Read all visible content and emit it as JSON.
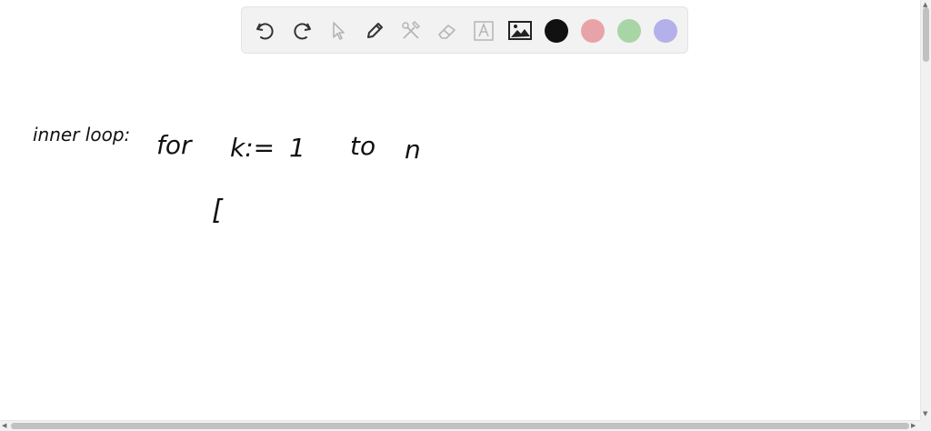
{
  "toolbar": {
    "tools": [
      {
        "name": "undo-icon",
        "label": "Undo"
      },
      {
        "name": "redo-icon",
        "label": "Redo"
      },
      {
        "name": "pointer-icon",
        "label": "Select"
      },
      {
        "name": "pen-icon",
        "label": "Pen"
      },
      {
        "name": "tools-icon",
        "label": "Tools"
      },
      {
        "name": "eraser-icon",
        "label": "Eraser"
      },
      {
        "name": "text-icon",
        "label": "Text"
      },
      {
        "name": "image-icon",
        "label": "Image"
      }
    ],
    "colors": [
      "#111111",
      "#e8a3a8",
      "#a8d5a6",
      "#b3b0ea"
    ]
  },
  "canvas": {
    "handwriting": {
      "line1_label": "inner loop:",
      "line1_for": "for",
      "line1_var": "k:=",
      "line1_start": "1",
      "line1_to": "to",
      "line1_end": "n",
      "line2_bracket": "["
    }
  }
}
